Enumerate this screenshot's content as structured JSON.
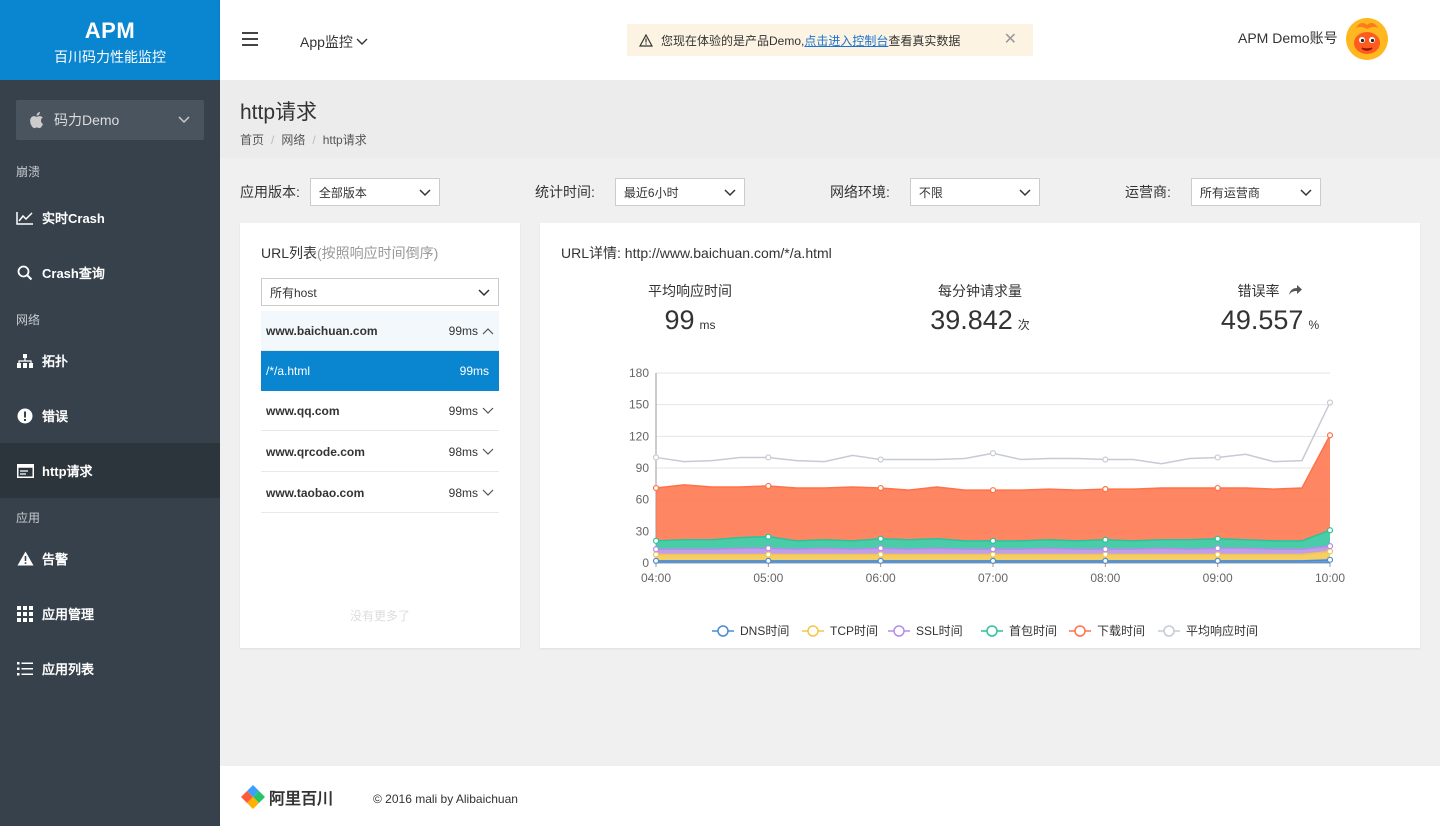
{
  "brand": {
    "title": "APM",
    "subtitle": "百川码力性能监控"
  },
  "app_selector": {
    "value": "码力Demo"
  },
  "sidebar": {
    "sections": [
      {
        "label": "崩溃"
      },
      {
        "label": "网络"
      },
      {
        "label": "应用"
      }
    ],
    "items": [
      {
        "label": "实时Crash",
        "icon": "line-chart-icon"
      },
      {
        "label": "Crash查询",
        "icon": "search-icon"
      },
      {
        "label": "拓扑",
        "icon": "topology-icon"
      },
      {
        "label": "错误",
        "icon": "alert-circle-icon"
      },
      {
        "label": "http请求",
        "icon": "browser-window-icon",
        "active": true
      },
      {
        "label": "告警",
        "icon": "warning-triangle-icon"
      },
      {
        "label": "应用管理",
        "icon": "grid-icon"
      },
      {
        "label": "应用列表",
        "icon": "list-icon"
      }
    ]
  },
  "header": {
    "app_menu": "App监控",
    "notice": {
      "prefix": "您现在体验的是产品Demo, ",
      "link": "点击进入控制台",
      "suffix": "查看真实数据"
    },
    "account": "APM Demo账号"
  },
  "page": {
    "title": "http请求",
    "breadcrumb": [
      "首页",
      "网络",
      "http请求"
    ]
  },
  "filters": [
    {
      "label": "应用版本:",
      "value": "全部版本"
    },
    {
      "label": "统计时间:",
      "value": "最近6小时"
    },
    {
      "label": "网络环境:",
      "value": "不限"
    },
    {
      "label": "运营商:",
      "value": "所有运营商"
    }
  ],
  "url_list": {
    "title": "URL列表",
    "title_hint": "(按照响应时间倒序)",
    "host_filter": "所有host",
    "hosts": [
      {
        "name": "www.baichuan.com",
        "ms": "99ms",
        "expanded": true
      },
      {
        "name": "www.qq.com",
        "ms": "99ms"
      },
      {
        "name": "www.qrcode.com",
        "ms": "98ms"
      },
      {
        "name": "www.taobao.com",
        "ms": "98ms"
      }
    ],
    "selected_path": {
      "name": "/*/a.html",
      "ms": "99ms"
    },
    "footer": "没有更多了"
  },
  "detail": {
    "title": "URL详情: http://www.baichuan.com/*/a.html",
    "kpis": [
      {
        "label": "平均响应时间",
        "value": "99",
        "unit": "ms"
      },
      {
        "label": "每分钟请求量",
        "value": "39.842",
        "unit": "次"
      },
      {
        "label": "错误率",
        "value": "49.557",
        "unit": "%"
      }
    ]
  },
  "chart_data": {
    "type": "area",
    "x_labels": [
      "04:00",
      "05:00",
      "06:00",
      "07:00",
      "08:00",
      "09:00",
      "10:00"
    ],
    "x": [
      0,
      0.25,
      0.5,
      0.75,
      1,
      1.25,
      1.5,
      1.75,
      2,
      2.25,
      2.5,
      2.75,
      3,
      3.25,
      3.5,
      3.75,
      4,
      4.25,
      4.5,
      4.75,
      5,
      5.25,
      5.5,
      5.75,
      6
    ],
    "ylim": [
      0,
      180
    ],
    "yticks": [
      0,
      30,
      60,
      90,
      120,
      150,
      180
    ],
    "stacked": true,
    "grid": true,
    "legend_position": "bottom",
    "series": [
      {
        "name": "DNS时间",
        "color": "#4a8bd6",
        "values": [
          2,
          2,
          2,
          2,
          2,
          2,
          2,
          2,
          2,
          2,
          2,
          2,
          2,
          2,
          2,
          2,
          2,
          2,
          2,
          2,
          2,
          2,
          2,
          2,
          3
        ]
      },
      {
        "name": "TCP时间",
        "color": "#f3c64a",
        "values": [
          6,
          6,
          6,
          6,
          6,
          6,
          6,
          6,
          6,
          6,
          6,
          6,
          6,
          6,
          6,
          6,
          6,
          6,
          6,
          6,
          6,
          6,
          6,
          6,
          8
        ]
      },
      {
        "name": "SSL时间",
        "color": "#b48de8",
        "values": [
          5,
          5,
          5,
          6,
          6,
          5,
          6,
          5,
          6,
          5,
          6,
          5,
          5,
          5,
          6,
          5,
          5,
          5,
          6,
          5,
          6,
          6,
          5,
          5,
          5
        ]
      },
      {
        "name": "首包时间",
        "color": "#2bc39a",
        "values": [
          8,
          9,
          9,
          10,
          11,
          8,
          8,
          8,
          9,
          9,
          9,
          8,
          8,
          8,
          8,
          8,
          9,
          8,
          8,
          9,
          9,
          8,
          8,
          8,
          15
        ]
      },
      {
        "name": "下载时间",
        "color": "#ff7148",
        "values": [
          50,
          52,
          50,
          48,
          48,
          50,
          49,
          51,
          48,
          47,
          49,
          48,
          48,
          48,
          48,
          48,
          48,
          49,
          49,
          49,
          48,
          49,
          49,
          50,
          90
        ]
      },
      {
        "name": "平均响应时间",
        "color": "#c6cbd3",
        "overlay": true,
        "values": [
          100,
          96,
          97,
          100,
          100,
          97,
          96,
          102,
          98,
          98,
          98,
          99,
          104,
          98,
          99,
          99,
          98,
          98,
          94,
          99,
          100,
          103,
          96,
          97,
          152
        ]
      }
    ]
  },
  "footer": {
    "logo_text": "阿里百川",
    "copyright": "© 2016 mali by Alibaichuan"
  }
}
